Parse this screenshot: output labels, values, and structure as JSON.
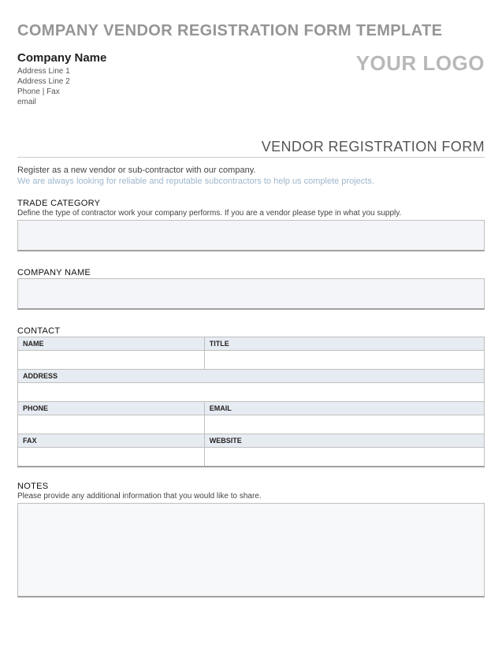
{
  "pageTitle": "COMPANY VENDOR REGISTRATION FORM TEMPLATE",
  "company": {
    "name": "Company Name",
    "addr1": "Address Line 1",
    "addr2": "Address Line 2",
    "phoneFax": "Phone | Fax",
    "email": "email"
  },
  "logoText": "YOUR LOGO",
  "formHeading": "VENDOR REGISTRATION FORM",
  "intro1": "Register as a new vendor or sub-contractor with our company.",
  "intro2": "We are always looking for reliable and reputable subcontractors to help us complete projects.",
  "sections": {
    "trade": {
      "label": "TRADE CATEGORY",
      "hint": "Define the type of contractor work your company performs. If you are a vendor please type in what you supply.",
      "value": ""
    },
    "companyName": {
      "label": "COMPANY NAME",
      "value": ""
    },
    "contact": {
      "label": "CONTACT",
      "fields": {
        "name": "NAME",
        "title": "TITLE",
        "address": "ADDRESS",
        "phone": "PHONE",
        "email": "EMAIL",
        "fax": "FAX",
        "website": "WEBSITE"
      },
      "values": {
        "name": "",
        "title": "",
        "address": "",
        "phone": "",
        "email": "",
        "fax": "",
        "website": ""
      }
    },
    "notes": {
      "label": "NOTES",
      "hint": "Please provide any additional information that you would like to share.",
      "value": ""
    }
  }
}
